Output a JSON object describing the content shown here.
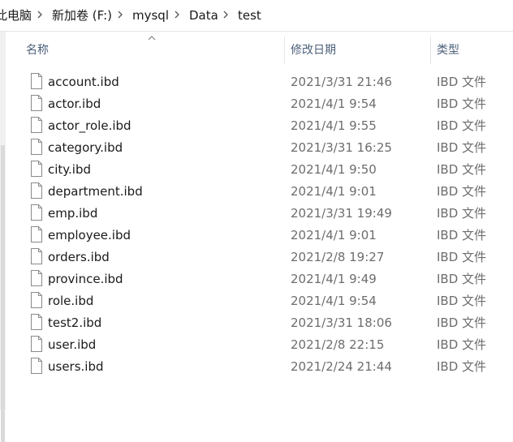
{
  "breadcrumb": {
    "items": [
      "此电脑",
      "新加卷 (F:)",
      "mysql",
      "Data",
      "test"
    ],
    "separator_icon": "chevron-right-icon"
  },
  "columns": {
    "name": "名称",
    "date": "修改日期",
    "type": "类型"
  },
  "sort": {
    "column": "name",
    "direction": "ascending",
    "icon": "sort-up-icon"
  },
  "files": [
    {
      "name": "account.ibd",
      "date": "2021/3/31 21:46",
      "type": "IBD 文件"
    },
    {
      "name": "actor.ibd",
      "date": "2021/4/1 9:54",
      "type": "IBD 文件"
    },
    {
      "name": "actor_role.ibd",
      "date": "2021/4/1 9:55",
      "type": "IBD 文件"
    },
    {
      "name": "category.ibd",
      "date": "2021/3/31 16:25",
      "type": "IBD 文件"
    },
    {
      "name": "city.ibd",
      "date": "2021/4/1 9:50",
      "type": "IBD 文件"
    },
    {
      "name": "department.ibd",
      "date": "2021/4/1 9:01",
      "type": "IBD 文件"
    },
    {
      "name": "emp.ibd",
      "date": "2021/3/31 19:49",
      "type": "IBD 文件"
    },
    {
      "name": "employee.ibd",
      "date": "2021/4/1 9:01",
      "type": "IBD 文件"
    },
    {
      "name": "orders.ibd",
      "date": "2021/2/8 19:27",
      "type": "IBD 文件"
    },
    {
      "name": "province.ibd",
      "date": "2021/4/1 9:49",
      "type": "IBD 文件"
    },
    {
      "name": "role.ibd",
      "date": "2021/4/1 9:54",
      "type": "IBD 文件"
    },
    {
      "name": "test2.ibd",
      "date": "2021/3/31 18:06",
      "type": "IBD 文件"
    },
    {
      "name": "user.ibd",
      "date": "2021/2/8 22:15",
      "type": "IBD 文件"
    },
    {
      "name": "users.ibd",
      "date": "2021/2/24 21:44",
      "type": "IBD 文件"
    }
  ]
}
